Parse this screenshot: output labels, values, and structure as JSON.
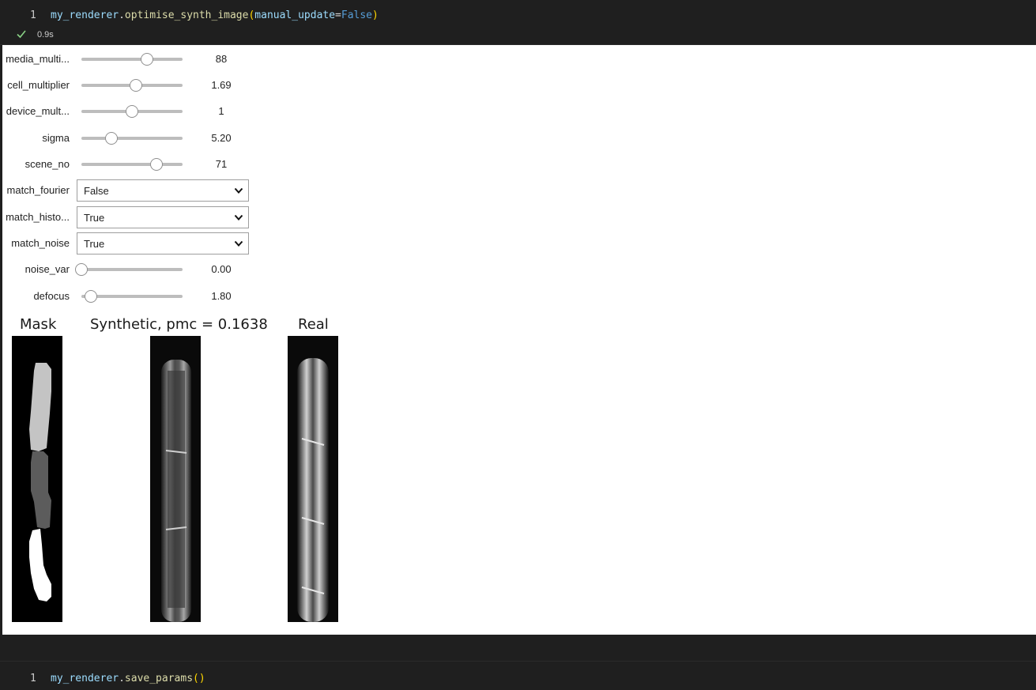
{
  "cell1": {
    "line_number": "1",
    "code": {
      "obj": "my_renderer",
      "dot": ".",
      "method": "optimise_synth_image",
      "open": "(",
      "param": "manual_update",
      "eq": "=",
      "value": "False",
      "close": ")"
    },
    "exec_time": "0.9s",
    "status_icon": "check-icon"
  },
  "widgets": {
    "sliders": [
      {
        "label": "media_multi...",
        "value": "88",
        "level": 0.65
      },
      {
        "label": "cell_multiplier",
        "value": "1.69",
        "level": 0.54
      },
      {
        "label": "device_mult...",
        "value": "1",
        "level": 0.5
      },
      {
        "label": "sigma",
        "value": "5.20",
        "level": 0.3
      },
      {
        "label": "scene_no",
        "value": "71",
        "level": 0.74
      }
    ],
    "dropdowns": [
      {
        "label": "match_fourier",
        "value": "False"
      },
      {
        "label": "match_histo...",
        "value": "True"
      },
      {
        "label": "match_noise",
        "value": "True"
      }
    ],
    "sliders2": [
      {
        "label": "noise_var",
        "value": "0.00",
        "level": 0.0
      },
      {
        "label": "defocus",
        "value": "1.80",
        "level": 0.09
      }
    ]
  },
  "plots": {
    "mask_title": "Mask",
    "synthetic_title": "Synthetic, pmc = 0.1638",
    "real_title": "Real"
  },
  "cell2": {
    "line_number": "1",
    "code": {
      "obj": "my_renderer",
      "dot": ".",
      "method": "save_params",
      "open": "(",
      "close": ")"
    }
  },
  "colors": {
    "editor_bg": "#1f1f1f",
    "check_green": "#89d185",
    "identifier": "#9cdcfe",
    "function": "#dcdcaa",
    "keyword": "#569cd6",
    "bracket": "#ffd700"
  }
}
